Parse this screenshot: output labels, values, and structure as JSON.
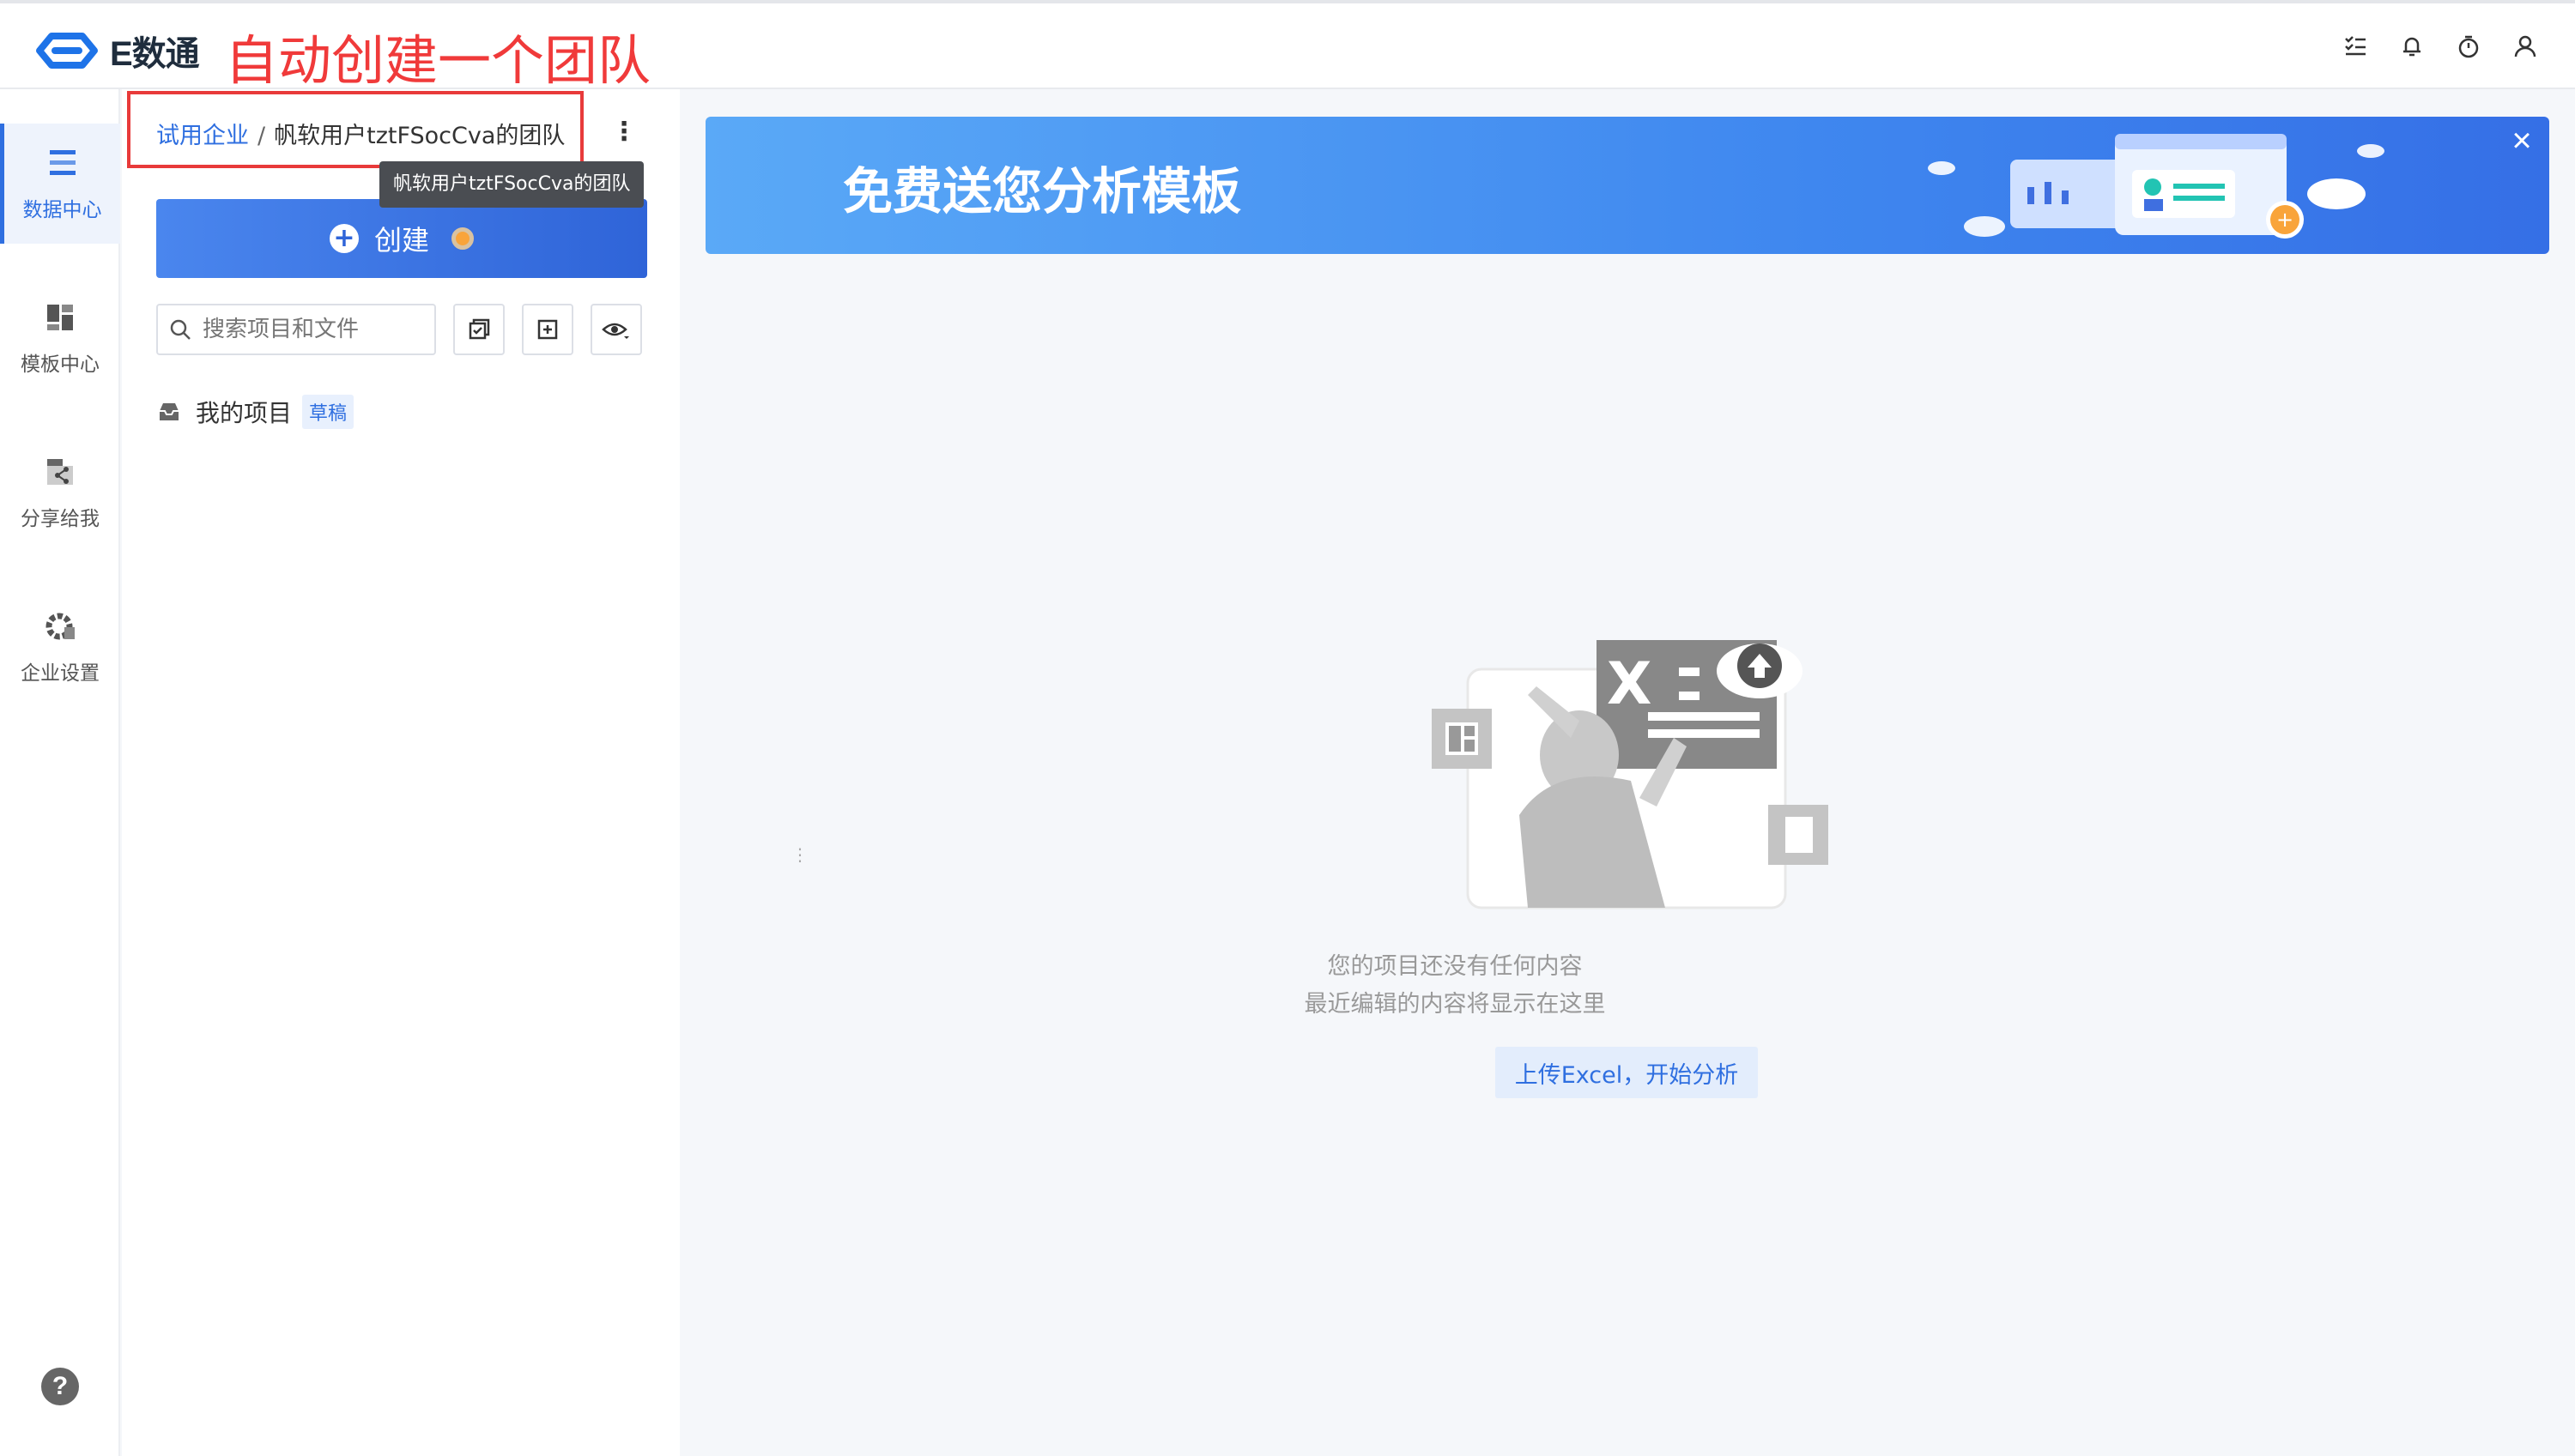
{
  "header": {
    "logo_text": "E数通",
    "annotation": "自动创建一个团队",
    "icons": [
      "tasks-icon",
      "bell-icon",
      "timer-icon",
      "user-icon"
    ]
  },
  "nav": {
    "items": [
      {
        "label": "数据中心",
        "icon": "data-center-icon",
        "active": true
      },
      {
        "label": "模板中心",
        "icon": "template-icon",
        "active": false
      },
      {
        "label": "分享给我",
        "icon": "share-icon",
        "active": false
      },
      {
        "label": "企业设置",
        "icon": "settings-icon",
        "active": false
      }
    ],
    "help_label": "?"
  },
  "panel": {
    "breadcrumb_root": "试用企业",
    "breadcrumb_sep": "/",
    "breadcrumb_current": "帆软用户tztFSocCva的团队",
    "more_label": "⋮",
    "tooltip": "帆软用户tztFSocCva的团队",
    "create_label": "创建",
    "search_placeholder": "搜索项目和文件",
    "my_projects_label": "我的项目",
    "draft_badge": "草稿"
  },
  "banner": {
    "title": "免费送您分析模板",
    "close_label": "×"
  },
  "empty": {
    "line1": "您的项目还没有任何内容",
    "line2": "最近编辑的内容将显示在这里",
    "upload_label": "上传Excel，开始分析"
  },
  "colors": {
    "accent": "#2f6fe0",
    "annotation_red": "#f03a3a",
    "banner_start": "#5aa9f7",
    "banner_end": "#356fe6"
  }
}
